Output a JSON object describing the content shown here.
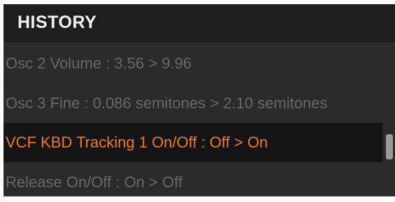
{
  "history": {
    "title": "HISTORY",
    "items": [
      {
        "label": "Osc 2 Volume : 3.56 > 9.96",
        "active": false
      },
      {
        "label": "Osc 3 Fine : 0.086 semitones > 2.10 semitones",
        "active": false
      },
      {
        "label": "VCF KBD Tracking 1 On/Off : Off > On",
        "active": true
      },
      {
        "label": "Release On/Off : On > Off",
        "active": false
      }
    ]
  },
  "colors": {
    "panel_bg": "#2b2b2b",
    "header_bg": "#1e1e1e",
    "active_row_bg": "#141414",
    "active_text": "#ef7a32",
    "inactive_text": "#686868"
  }
}
